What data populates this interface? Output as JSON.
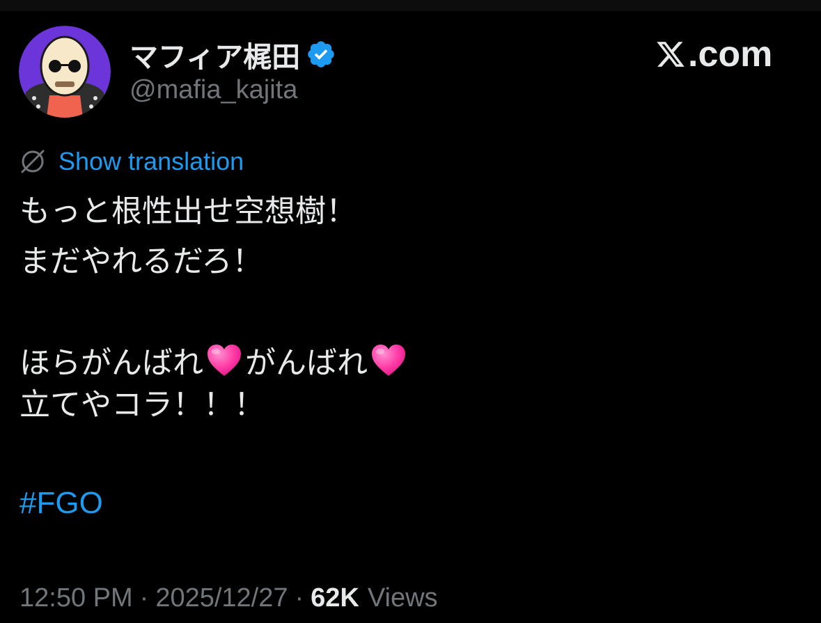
{
  "author": {
    "display_name": "マフィア梶田",
    "handle": "@mafia_kajita",
    "verified": true,
    "verified_color": "#1d9bf0"
  },
  "brand": {
    "domain": ".com",
    "logo_icon": "x-logo-icon"
  },
  "translation": {
    "label": "Show translation",
    "icon": "globe-icon",
    "color": "#1d9bf0"
  },
  "tweet": {
    "line1": "もっと根性出せ空想樹！",
    "line2": "まだやれるだろ！",
    "line3_part1": "ほらがんばれ",
    "line3_part2": "がんばれ",
    "line3_emoji": "pink-heart-icon",
    "line4": "立てやコラ！！！",
    "hashtag": "#FGO"
  },
  "meta": {
    "time": "12:50 PM",
    "separator": "·",
    "date": "2025/12/27",
    "views_count": "62K",
    "views_label": "Views"
  },
  "colors": {
    "background": "#000000",
    "text": "#e7e9ea",
    "muted": "#71767b",
    "accent": "#1d9bf0",
    "heart": "#ff3aa5"
  }
}
